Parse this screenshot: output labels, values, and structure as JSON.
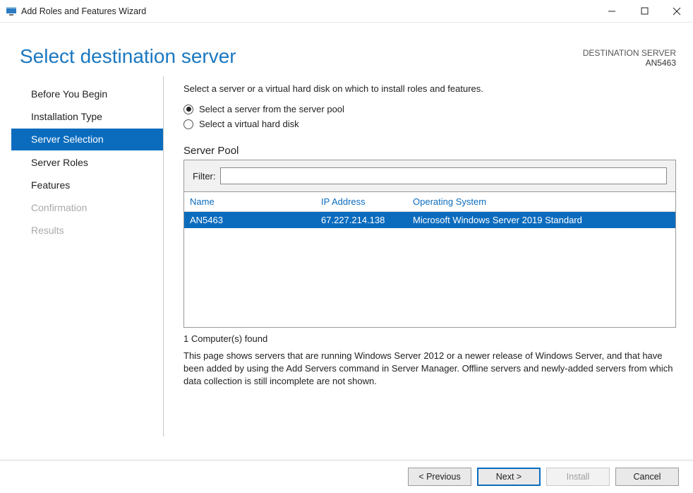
{
  "window": {
    "title": "Add Roles and Features Wizard"
  },
  "header": {
    "title": "Select destination server",
    "destination_label": "DESTINATION SERVER",
    "destination_server": "AN5463"
  },
  "sidebar": {
    "items": [
      {
        "label": "Before You Begin",
        "state": "normal"
      },
      {
        "label": "Installation Type",
        "state": "normal"
      },
      {
        "label": "Server Selection",
        "state": "selected"
      },
      {
        "label": "Server Roles",
        "state": "normal"
      },
      {
        "label": "Features",
        "state": "normal"
      },
      {
        "label": "Confirmation",
        "state": "disabled"
      },
      {
        "label": "Results",
        "state": "disabled"
      }
    ]
  },
  "content": {
    "intro": "Select a server or a virtual hard disk on which to install roles and features.",
    "radio1": "Select a server from the server pool",
    "radio2": "Select a virtual hard disk",
    "radio_selected": 0,
    "pool_label": "Server Pool",
    "filter_label": "Filter:",
    "filter_value": "",
    "columns": {
      "c1": "Name",
      "c2": "IP Address",
      "c3": "Operating System"
    },
    "rows": [
      {
        "name": "AN5463",
        "ip": "67.227.214.138",
        "os": "Microsoft Windows Server 2019 Standard",
        "selected": true
      }
    ],
    "count": "1 Computer(s) found",
    "help": "This page shows servers that are running Windows Server 2012 or a newer release of Windows Server, and that have been added by using the Add Servers command in Server Manager. Offline servers and newly-added servers from which data collection is still incomplete are not shown."
  },
  "footer": {
    "previous": "< Previous",
    "next": "Next >",
    "install": "Install",
    "cancel": "Cancel"
  }
}
